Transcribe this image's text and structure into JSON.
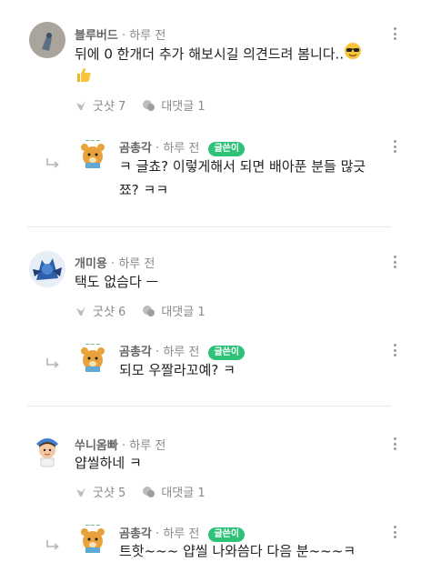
{
  "threads": [
    {
      "author": "블루버드",
      "time": "하루 전",
      "text_line1": "뒤에 0 한개더 추가 해보시길 의견드려 봄니다..",
      "likes_label": "굿샷 7",
      "replies_label": "대댓글 1",
      "reply": {
        "author": "곰총각",
        "time": "하루 전",
        "badge": "글쓴이",
        "text_line1": "ㅋ 글쵸? 이렇게해서 되면 배아푼 분들 많긋",
        "text_line2": "쬬? ㅋㅋ"
      }
    },
    {
      "author": "개미용",
      "time": "하루 전",
      "text_line1": "택도 없슴다 ㅡ",
      "likes_label": "굿샷 6",
      "replies_label": "대댓글 1",
      "reply": {
        "author": "곰총각",
        "time": "하루 전",
        "badge": "글쓴이",
        "text_line1": "되모 우짤라꼬예? ㅋ"
      }
    },
    {
      "author": "쑤니옴빠",
      "time": "하루 전",
      "text_line1": "얍씰하네 ㅋ",
      "likes_label": "굿샷 5",
      "replies_label": "대댓글 1",
      "reply": {
        "author": "곰총각",
        "time": "하루 전",
        "badge": "글쓴이",
        "text_line1": "트핫~~~ 얍씰 나와씀다 다음 분~~~ㅋ"
      }
    }
  ],
  "separator": "·"
}
